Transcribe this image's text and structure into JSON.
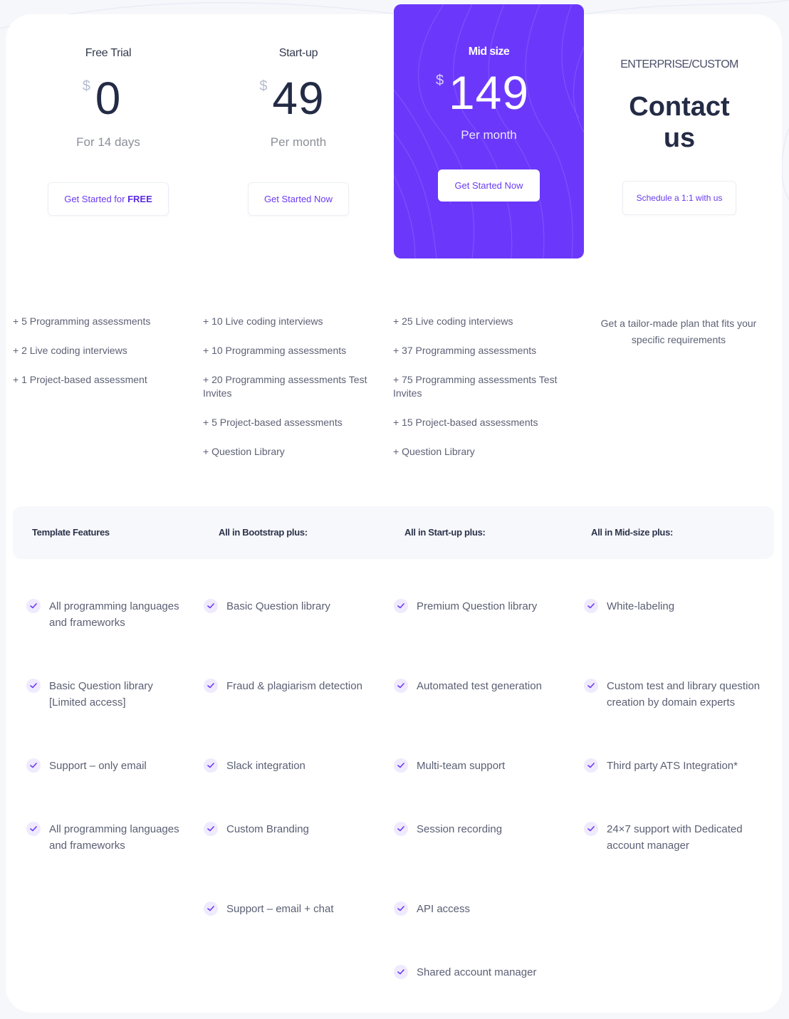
{
  "colors": {
    "accent": "#6b38fb",
    "button_text": "#6a3bf0",
    "heading": "#232b45",
    "body_text": "#5a5f73",
    "check_bg": "#efeafd"
  },
  "plans": [
    {
      "name": "Free Trial",
      "currency": "$",
      "price": "0",
      "period": "For 14 days",
      "cta_prefix": "Get Started for ",
      "cta_emphasis": "FREE",
      "includes": [
        "+ 5 Programming assessments",
        "+ 2 Live coding interviews",
        "+ 1 Project-based assessment"
      ]
    },
    {
      "name": "Start-up",
      "currency": "$",
      "price": "49",
      "period": "Per month",
      "cta": "Get Started Now",
      "includes": [
        "+ 10 Live coding interviews",
        "+ 10 Programming assessments",
        "+ 20 Programming assessments Test Invites",
        "+ 5 Project-based assessments",
        "+ Question Library"
      ]
    },
    {
      "name": "Mid size",
      "currency": "$",
      "price": "149",
      "period": "Per month",
      "cta": "Get Started Now",
      "featured": true,
      "includes": [
        "+ 25 Live coding interviews",
        "+ 37 Programming assessments",
        "+ 75 Programming assessments Test Invites",
        "+ 15 Project-based assessments",
        "+ Question Library"
      ]
    },
    {
      "name": "ENTERPRISE/CUSTOM",
      "headline": "Contact us",
      "cta": "Schedule a 1:1 with us",
      "description": "Get a tailor-made plan that fits your specific requirements"
    }
  ],
  "features": {
    "headers": [
      "Template Features",
      "All in Bootstrap plus:",
      "All in Start-up plus:",
      "All in Mid-size plus:"
    ],
    "columns": [
      [
        "All programming languages and frameworks",
        "Basic Question library [Limited access]",
        "Support – only email",
        "All programming languages and frameworks"
      ],
      [
        "Basic Question library",
        "Fraud & plagiarism detection",
        "Slack integration",
        "Custom Branding",
        "Support – email + chat"
      ],
      [
        "Premium Question library",
        "Automated test generation",
        "Multi-team support",
        "Session recording",
        "API access",
        "Shared account manager"
      ],
      [
        "White-labeling",
        "Custom test and library question creation by domain experts",
        "Third party ATS Integration*",
        "24×7 support with Dedicated account manager"
      ]
    ]
  }
}
